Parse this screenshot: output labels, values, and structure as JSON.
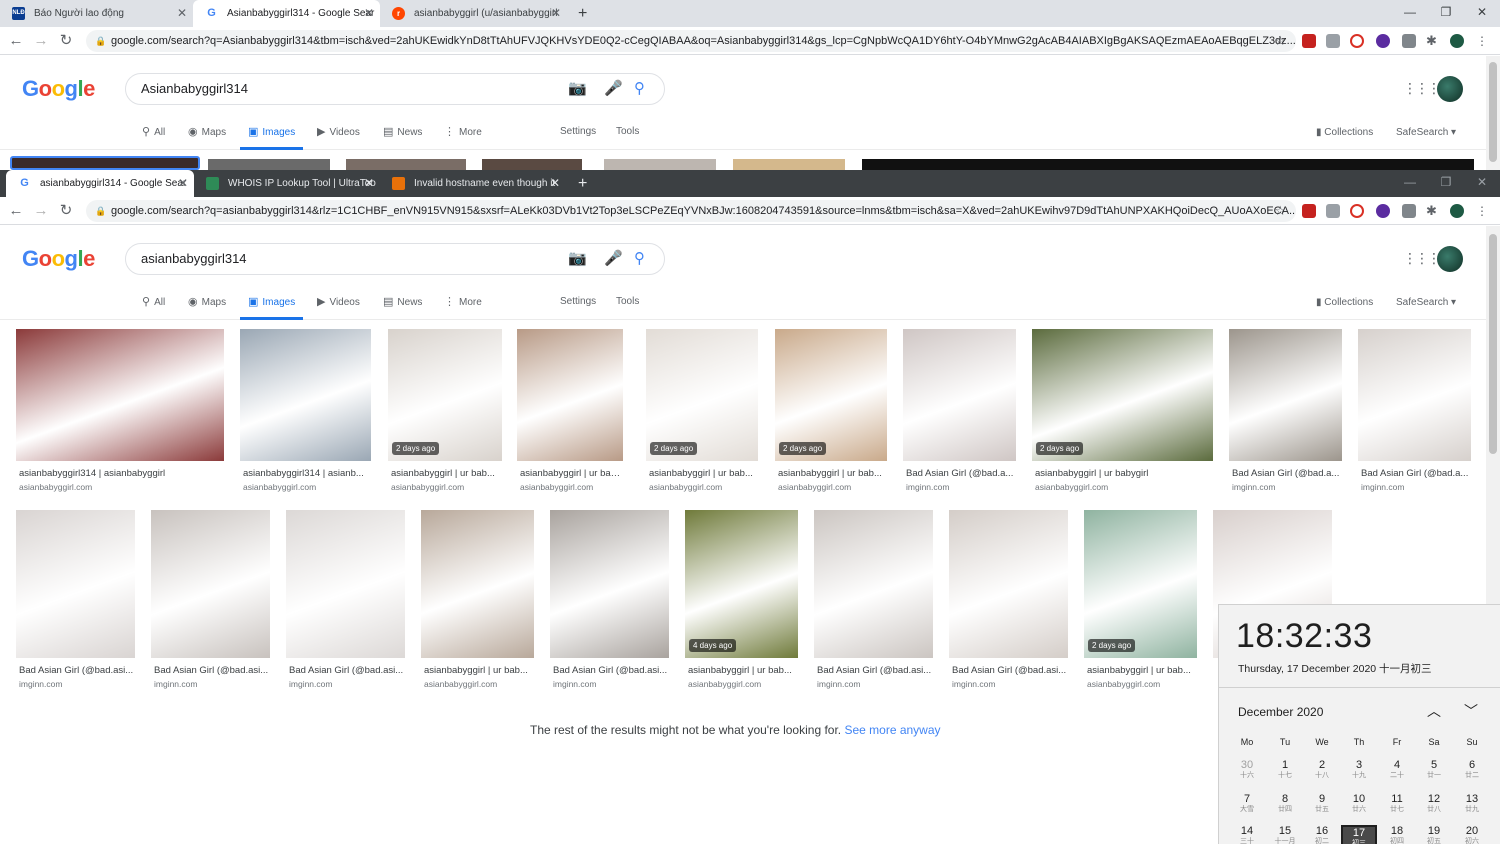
{
  "window1": {
    "tabs": [
      {
        "label": "Báo Người lao động",
        "favicon": "NLĐ",
        "color": "#0b3d91"
      },
      {
        "label": "Asianbabyggirl314 - Google Sear",
        "favicon": "G",
        "color": "#4285f4"
      },
      {
        "label": "asianbabyggirl (u/asianbabyggirl",
        "favicon": "r",
        "color": "#ff4500"
      }
    ],
    "url": "google.com/search?q=Asianbabyggirl314&tbm=isch&ved=2ahUKEwidkYnD8tTtAhUFVJQKHVsYDE0Q2-cCegQIABAA&oq=Asianbabyggirl314&gs_lcp=CgNpbWcQA1DY6htY-O4bYMnwG2gAcAB4AIABXIgBgAKSAQEzmAEAoAEBqgELZ3dz...",
    "query": "Asianbabyggirl314"
  },
  "window2": {
    "tabs": [
      {
        "label": "asianbabyggirl314 - Google Sear",
        "favicon": "G",
        "color": "#4285f4"
      },
      {
        "label": "WHOIS IP Lookup Tool | UltraToo",
        "favicon": "",
        "color": "#2e8b57"
      },
      {
        "label": "Invalid hostname even though it",
        "favicon": "",
        "color": "#e8710a"
      }
    ],
    "url": "google.com/search?q=asianbabyggirl314&rlz=1C1CHBF_enVN915VN915&sxsrf=ALeKk03DVb1Vt2Top3eLSCPeZEqYVNxBJw:1608204743591&source=lnms&tbm=isch&sa=X&ved=2ahUKEwihv97D9dTtAhUNPXAKHQoiDecQ_AUoAXoECA...",
    "query": "asianbabyggirl314"
  },
  "google": {
    "logo": "Google",
    "nav": [
      "All",
      "Maps",
      "Images",
      "Videos",
      "News",
      "More"
    ],
    "settings": "Settings",
    "tools": "Tools",
    "collections": "Collections",
    "safesearch": "SafeSearch ▾"
  },
  "results_row1": [
    {
      "title": "asianbabyggirl314 | asianbabyggirl",
      "source": "asianbabyggirl.com",
      "badge": "",
      "bg": "#8b3a3a"
    },
    {
      "title": "asianbabyggirl314 | asianb...",
      "source": "asianbabyggirl.com",
      "badge": "",
      "bg": "#9aa7b4"
    },
    {
      "title": "asianbabyggirl | ur bab...",
      "source": "asianbabyggirl.com",
      "badge": "2 days ago",
      "bg": "#d8d2cc"
    },
    {
      "title": "asianbabyggirl | ur bab...",
      "source": "asianbabyggirl.com",
      "badge": "",
      "bg": "#b89a86"
    },
    {
      "title": "asianbabyggirl | ur bab...",
      "source": "asianbabyggirl.com",
      "badge": "2 days ago",
      "bg": "#e2dcd6"
    },
    {
      "title": "asianbabyggirl | ur bab...",
      "source": "asianbabyggirl.com",
      "badge": "2 days ago",
      "bg": "#c9a98a"
    },
    {
      "title": "Bad Asian Girl (@bad.a...",
      "source": "imginn.com",
      "badge": "",
      "bg": "#cfc6c4"
    },
    {
      "title": "asianbabyggirl | ur babygirl",
      "source": "asianbabyggirl.com",
      "badge": "2 days ago",
      "bg": "#5b6b3d"
    },
    {
      "title": "Bad Asian Girl (@bad.a...",
      "source": "imginn.com",
      "badge": "",
      "bg": "#9c958c"
    },
    {
      "title": "Bad Asian Girl (@bad.a...",
      "source": "imginn.com",
      "badge": "",
      "bg": "#d6d0cc"
    }
  ],
  "results_row2": [
    {
      "title": "Bad Asian Girl (@bad.asi...",
      "source": "imginn.com",
      "badge": "",
      "bg": "#d9d4d2"
    },
    {
      "title": "Bad Asian Girl (@bad.asi...",
      "source": "imginn.com",
      "badge": "",
      "bg": "#c8c2be"
    },
    {
      "title": "Bad Asian Girl (@bad.asi...",
      "source": "imginn.com",
      "badge": "",
      "bg": "#dcd8d6"
    },
    {
      "title": "asianbabyggirl | ur bab...",
      "source": "asianbabyggirl.com",
      "badge": "",
      "bg": "#b8a89a"
    },
    {
      "title": "Bad Asian Girl (@bad.asi...",
      "source": "imginn.com",
      "badge": "",
      "bg": "#a9a39e"
    },
    {
      "title": "asianbabyggirl | ur bab...",
      "source": "asianbabyggirl.com",
      "badge": "4 days ago",
      "bg": "#6f7a3a"
    },
    {
      "title": "Bad Asian Girl (@bad.asi...",
      "source": "imginn.com",
      "badge": "",
      "bg": "#cbc5c1"
    },
    {
      "title": "Bad Asian Girl (@bad.asi...",
      "source": "imginn.com",
      "badge": "",
      "bg": "#d4cdc8"
    },
    {
      "title": "asianbabyggirl | ur bab...",
      "source": "asianbabyggirl.com",
      "badge": "2 days ago",
      "bg": "#8fb3a0"
    },
    {
      "title": "",
      "source": "",
      "badge": "",
      "bg": "#d8cfcc"
    }
  ],
  "rest": {
    "text": "The rest of the results might not be what you're looking for.",
    "link": "See more anyway"
  },
  "calendar": {
    "time": "18:32:33",
    "date": "Thursday, 17 December 2020 十一月初三",
    "month": "December 2020",
    "dow": [
      "Mo",
      "Tu",
      "We",
      "Th",
      "Fr",
      "Sa",
      "Su"
    ],
    "weeks": [
      [
        {
          "d": "30",
          "l": "十六",
          "m": true
        },
        {
          "d": "1",
          "l": "十七"
        },
        {
          "d": "2",
          "l": "十八"
        },
        {
          "d": "3",
          "l": "十九"
        },
        {
          "d": "4",
          "l": "二十"
        },
        {
          "d": "5",
          "l": "廿一"
        },
        {
          "d": "6",
          "l": "廿二"
        }
      ],
      [
        {
          "d": "7",
          "l": "大雪"
        },
        {
          "d": "8",
          "l": "廿四"
        },
        {
          "d": "9",
          "l": "廿五"
        },
        {
          "d": "10",
          "l": "廿六"
        },
        {
          "d": "11",
          "l": "廿七"
        },
        {
          "d": "12",
          "l": "廿八"
        },
        {
          "d": "13",
          "l": "廿九"
        }
      ],
      [
        {
          "d": "14",
          "l": "三十"
        },
        {
          "d": "15",
          "l": "十一月"
        },
        {
          "d": "16",
          "l": "初二"
        },
        {
          "d": "17",
          "l": "初三",
          "today": true
        },
        {
          "d": "18",
          "l": "初四"
        },
        {
          "d": "19",
          "l": "初五"
        },
        {
          "d": "20",
          "l": "初六"
        }
      ]
    ]
  }
}
